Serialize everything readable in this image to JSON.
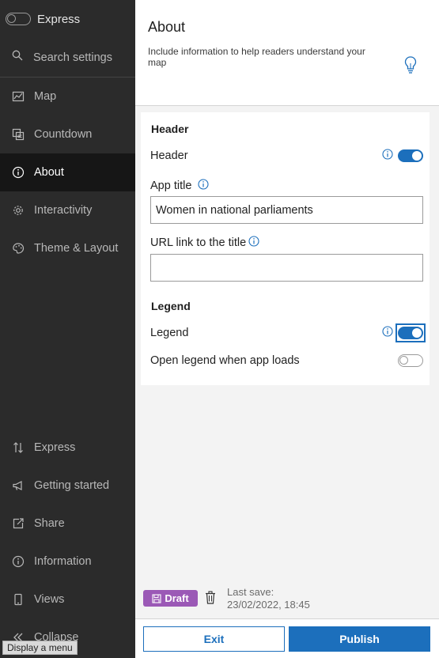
{
  "sidebar": {
    "express_toggle": {
      "label": "Express",
      "checked": false
    },
    "search": {
      "label": "Search settings",
      "icon": "search-icon"
    },
    "items": [
      {
        "label": "Map",
        "icon": "map-icon"
      },
      {
        "label": "Countdown",
        "icon": "countdown-icon"
      },
      {
        "label": "About",
        "icon": "info-icon",
        "active": true
      },
      {
        "label": "Interactivity",
        "icon": "gear-icon"
      },
      {
        "label": "Theme & Layout",
        "icon": "palette-icon"
      }
    ],
    "bottom_items": [
      {
        "label": "Express",
        "icon": "sort-arrows-icon"
      },
      {
        "label": "Getting started",
        "icon": "megaphone-icon"
      },
      {
        "label": "Share",
        "icon": "share-icon"
      },
      {
        "label": "Information",
        "icon": "info-icon"
      },
      {
        "label": "Views",
        "icon": "phone-icon"
      },
      {
        "label": "Collapse",
        "icon": "collapse-icon"
      }
    ],
    "tooltip": "Display a menu"
  },
  "main": {
    "title": "About",
    "description": "Include information to help readers understand your map",
    "header_section": {
      "title": "Header",
      "header_toggle": {
        "label": "Header",
        "checked": true
      },
      "app_title": {
        "label": "App title",
        "value": "Women in national parliaments"
      },
      "url_link": {
        "label": "URL link to the title",
        "value": ""
      }
    },
    "legend_section": {
      "title": "Legend",
      "legend_toggle": {
        "label": "Legend",
        "checked": true
      },
      "open_legend_toggle": {
        "label": "Open legend when app loads",
        "checked": false
      }
    }
  },
  "footer": {
    "draft_label": "Draft",
    "last_save_label": "Last save:",
    "last_save_time": "23/02/2022, 18:45",
    "exit_label": "Exit",
    "publish_label": "Publish"
  },
  "colors": {
    "accent": "#1c6fbc",
    "sidebar_bg": "#2b2b2b",
    "draft_badge": "#9b59b6"
  }
}
